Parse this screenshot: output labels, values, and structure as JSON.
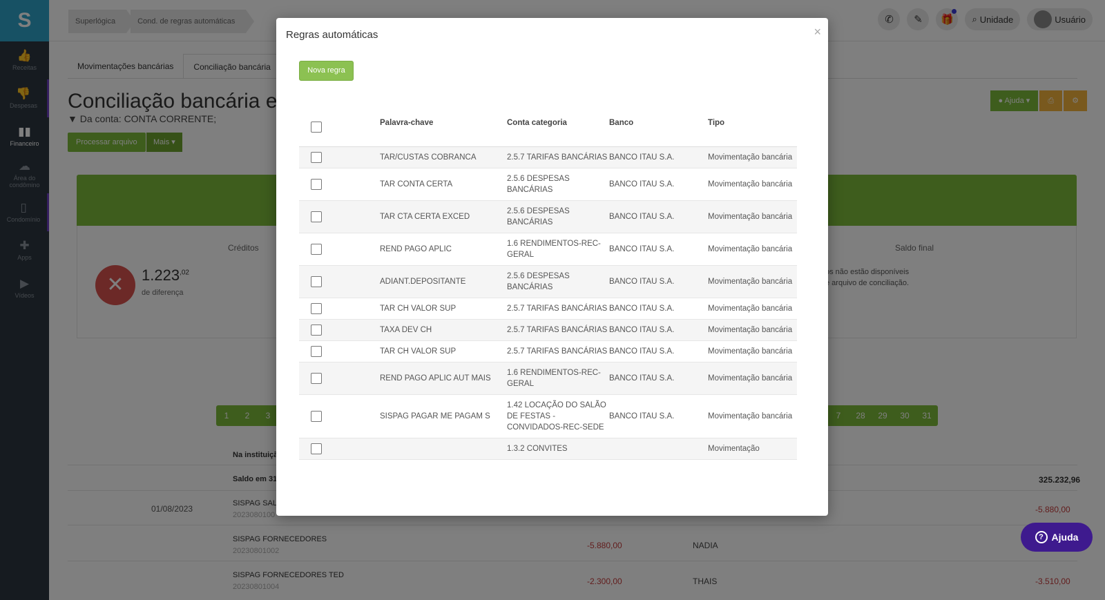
{
  "sidebar": {
    "logo": "S",
    "items": [
      {
        "label": "Receitas",
        "icon": "thumbs-up-icon"
      },
      {
        "label": "Despesas",
        "icon": "thumbs-down-icon"
      },
      {
        "label": "Financeiro",
        "icon": "bar-chart-icon"
      },
      {
        "label": "Área do condômino",
        "icon": "cloud-icon"
      },
      {
        "label": "Condomínio",
        "icon": "building-icon"
      },
      {
        "label": "Apps",
        "icon": "puzzle-icon"
      },
      {
        "label": "Vídeos",
        "icon": "video-camera-icon"
      }
    ]
  },
  "topbar": {
    "breadcrumbs": [
      "Superlógica",
      "Cond. de regras automáticas"
    ],
    "unidade_label": "Unidade",
    "usuario_label": "Usuário"
  },
  "page": {
    "tabs": [
      "Movimentações bancárias",
      "Conciliação bancária"
    ],
    "title": "Conciliação bancária em",
    "subtitle": "Da conta: CONTA CORRENTE;",
    "processar_label": "Processar arquivo",
    "mais_label": "Mais",
    "ajuda_label": "Ajuda",
    "creditos_label": "Créditos",
    "saldo_final_label": "Saldo final",
    "diff_value": "1.223",
    "diff_cents": ",02",
    "diff_label": "de diferença",
    "not_available_line1": "os não estão disponíveis",
    "not_available_line2": "e arquivo de conciliação.",
    "pager_left": [
      "1",
      "2",
      "3"
    ],
    "pager_right": [
      "7",
      "28",
      "29",
      "30",
      "31"
    ],
    "na_instituicao": "Na instituiçã",
    "saldo_em": "Saldo em 31",
    "saldo_value": "325.232,96",
    "date": "01/08/2023",
    "rows": [
      {
        "desc": "SISPAG SALÁ",
        "code": "2023080100",
        "amount": "",
        "name": "",
        "total": "-5.880,00"
      },
      {
        "desc": "SISPAG FORNECEDORES",
        "code": "20230801002",
        "amount": "-5.880,00",
        "name": "NADIA",
        "total": ""
      },
      {
        "desc": "SISPAG FORNECEDORES TED",
        "code": "20230801004",
        "amount": "-2.300,00",
        "name": "THAIS",
        "total": "-3.510,00"
      }
    ]
  },
  "modal": {
    "title": "Regras automáticas",
    "close": "×",
    "nova_regra": "Nova regra",
    "headers": {
      "keyword": "Palavra-chave",
      "category": "Conta categoria",
      "bank": "Banco",
      "type": "Tipo"
    },
    "rules": [
      {
        "keyword": "TAR/CUSTAS COBRANCA",
        "category": "2.5.7 TARIFAS BANCÁRIAS",
        "bank": "BANCO ITAU S.A.",
        "type": "Movimentação bancária"
      },
      {
        "keyword": "TAR CONTA CERTA",
        "category": "2.5.6 DESPESAS BANCÁRIAS",
        "bank": "BANCO ITAU S.A.",
        "type": "Movimentação bancária"
      },
      {
        "keyword": "TAR CTA CERTA EXCED",
        "category": "2.5.6 DESPESAS BANCÁRIAS",
        "bank": "BANCO ITAU S.A.",
        "type": "Movimentação bancária"
      },
      {
        "keyword": "REND PAGO APLIC",
        "category": "1.6 RENDIMENTOS-REC-GERAL",
        "bank": "BANCO ITAU S.A.",
        "type": "Movimentação bancária"
      },
      {
        "keyword": "ADIANT.DEPOSITANTE",
        "category": "2.5.6 DESPESAS BANCÁRIAS",
        "bank": "BANCO ITAU S.A.",
        "type": "Movimentação bancária"
      },
      {
        "keyword": "TAR CH VALOR SUP",
        "category": "2.5.7 TARIFAS BANCÁRIAS",
        "bank": "BANCO ITAU S.A.",
        "type": "Movimentação bancária"
      },
      {
        "keyword": "TAXA DEV CH",
        "category": "2.5.7 TARIFAS BANCÁRIAS",
        "bank": "BANCO ITAU S.A.",
        "type": "Movimentação bancária"
      },
      {
        "keyword": "TAR CH VALOR SUP",
        "category": "2.5.7 TARIFAS BANCÁRIAS",
        "bank": "BANCO ITAU S.A.",
        "type": "Movimentação bancária"
      },
      {
        "keyword": "REND PAGO APLIC AUT MAIS",
        "category": "1.6 RENDIMENTOS-REC-GERAL",
        "bank": "BANCO ITAU S.A.",
        "type": "Movimentação bancária"
      },
      {
        "keyword": "SISPAG PAGAR ME PAGAM S",
        "category": "1.42 LOCAÇÃO DO SALÃO DE FESTAS - CONVIDADOS-REC-SEDE",
        "bank": "BANCO ITAU S.A.",
        "type": "Movimentação bancária"
      },
      {
        "keyword": "",
        "category": "1.3.2 CONVITES",
        "bank": "",
        "type": "Movimentação"
      }
    ]
  },
  "help_widget": {
    "label": "Ajuda",
    "icon": "question-circle-icon"
  },
  "colors": {
    "primary_green": "#7dba3a",
    "nova_regra_green": "#8cc152",
    "sidebar_dark": "#2d3640",
    "logo_blue": "#2ea3c9",
    "help_purple": "#3e1a8e",
    "negative_red": "#c43a3a"
  }
}
